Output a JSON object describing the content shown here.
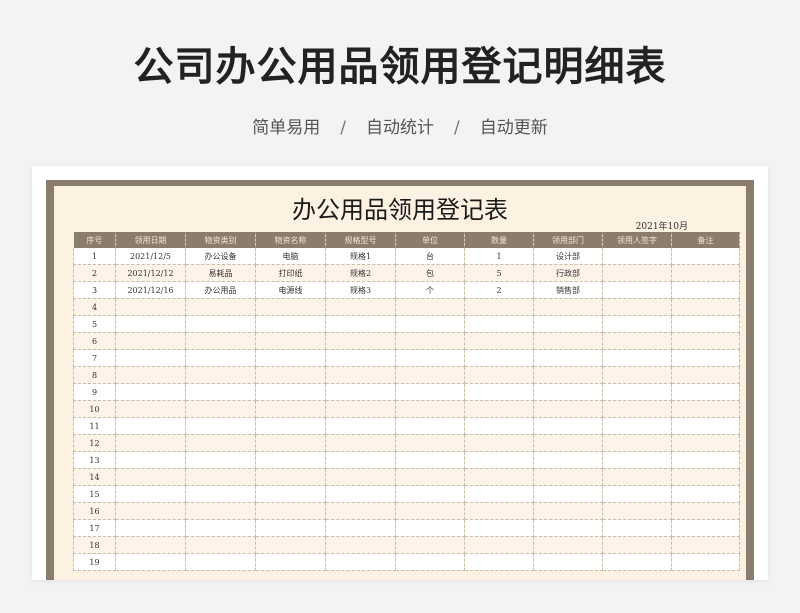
{
  "headline": "公司办公用品领用登记明细表",
  "tagline": [
    "简单易用",
    "自动统计",
    "自动更新"
  ],
  "tagline_separator": "/",
  "sheet": {
    "title": "办公用品领用登记表",
    "date": "2021年10月",
    "columns": [
      "序号",
      "领用日期",
      "物资类别",
      "物资名称",
      "规格型号",
      "单位",
      "数量",
      "领用部门",
      "领用人签字",
      "备注"
    ],
    "rows": [
      [
        "1",
        "2021/12/5",
        "办公设备",
        "电脑",
        "规格1",
        "台",
        "1",
        "设计部",
        "",
        ""
      ],
      [
        "2",
        "2021/12/12",
        "易耗品",
        "打印纸",
        "规格2",
        "包",
        "5",
        "行政部",
        "",
        ""
      ],
      [
        "3",
        "2021/12/16",
        "办公用品",
        "电源线",
        "规格3",
        "个",
        "2",
        "销售部",
        "",
        ""
      ],
      [
        "4",
        "",
        "",
        "",
        "",
        "",
        "",
        "",
        "",
        ""
      ],
      [
        "5",
        "",
        "",
        "",
        "",
        "",
        "",
        "",
        "",
        ""
      ],
      [
        "6",
        "",
        "",
        "",
        "",
        "",
        "",
        "",
        "",
        ""
      ],
      [
        "7",
        "",
        "",
        "",
        "",
        "",
        "",
        "",
        "",
        ""
      ],
      [
        "8",
        "",
        "",
        "",
        "",
        "",
        "",
        "",
        "",
        ""
      ],
      [
        "9",
        "",
        "",
        "",
        "",
        "",
        "",
        "",
        "",
        ""
      ],
      [
        "10",
        "",
        "",
        "",
        "",
        "",
        "",
        "",
        "",
        ""
      ],
      [
        "11",
        "",
        "",
        "",
        "",
        "",
        "",
        "",
        "",
        ""
      ],
      [
        "12",
        "",
        "",
        "",
        "",
        "",
        "",
        "",
        "",
        ""
      ],
      [
        "13",
        "",
        "",
        "",
        "",
        "",
        "",
        "",
        "",
        ""
      ],
      [
        "14",
        "",
        "",
        "",
        "",
        "",
        "",
        "",
        "",
        ""
      ],
      [
        "15",
        "",
        "",
        "",
        "",
        "",
        "",
        "",
        "",
        ""
      ],
      [
        "16",
        "",
        "",
        "",
        "",
        "",
        "",
        "",
        "",
        ""
      ],
      [
        "17",
        "",
        "",
        "",
        "",
        "",
        "",
        "",
        "",
        ""
      ],
      [
        "18",
        "",
        "",
        "",
        "",
        "",
        "",
        "",
        "",
        ""
      ],
      [
        "19",
        "",
        "",
        "",
        "",
        "",
        "",
        "",
        "",
        ""
      ]
    ]
  },
  "colors": {
    "header_bg": "#8b7d6d",
    "sheet_bg": "#fdf1e2",
    "page_bg": "#f2f3f5"
  }
}
